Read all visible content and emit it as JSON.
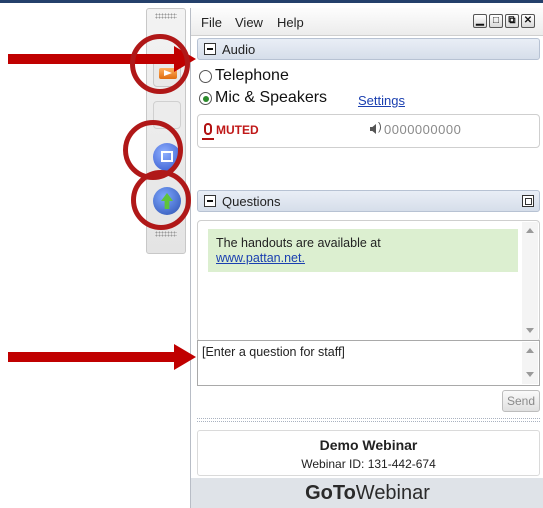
{
  "menu": {
    "file": "File",
    "view": "View",
    "help": "Help"
  },
  "window_controls": {
    "minimize": "▁",
    "restore": "□",
    "popout": "⧉",
    "close": "✕"
  },
  "audio": {
    "title": "Audio",
    "telephone_label": "Telephone",
    "mic_label": "Mic & Speakers",
    "settings_link": "Settings",
    "selected": "Mic & Speakers",
    "status": "MUTED",
    "level_dots": "0000000000"
  },
  "questions": {
    "title": "Questions",
    "message_line1": "The handouts are available at",
    "message_link": "www.pattan.net.",
    "input_placeholder": "[Enter a question for staff]",
    "send_label": "Send"
  },
  "webinar": {
    "name": "Demo Webinar",
    "id_line": "Webinar ID: 131-442-674"
  },
  "brand": {
    "goto": "GoTo",
    "webinar": "Webinar"
  },
  "icons": [
    "orange-arrow-icon",
    "screen-icon",
    "webinar-icon",
    "mic-icon",
    "speaker-icon"
  ],
  "colors": {
    "annotation_red": "#c00000",
    "muted_red": "#c01818",
    "note_green": "#dcefd0",
    "link_blue": "#1a3fb0"
  }
}
